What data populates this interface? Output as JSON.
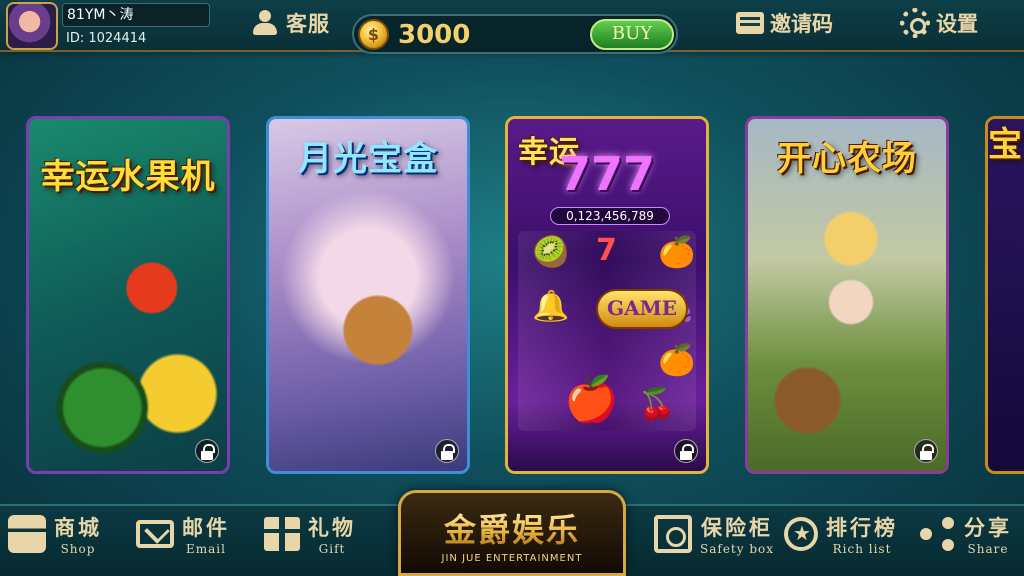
{
  "header": {
    "username": "81YM丶涛",
    "user_id": "ID: 1024414",
    "customer_service_label": "客服",
    "coins": "3000",
    "buy_label": "BUY",
    "invite_code_label": "邀请码",
    "settings_label": "设置"
  },
  "games": [
    {
      "title": "幸运水果机",
      "locked": true
    },
    {
      "title": "月光宝盒",
      "locked": true
    },
    {
      "title": "幸运",
      "reel_title": "777",
      "jackpot": "0,123,456,789",
      "badge": "GAME",
      "locked": true
    },
    {
      "title": "开心农场",
      "locked": true
    },
    {
      "title": "宝",
      "locked": false
    }
  ],
  "bottom_nav": [
    {
      "cn": "商城",
      "en": "Shop"
    },
    {
      "cn": "邮件",
      "en": "Email"
    },
    {
      "cn": "礼物",
      "en": "Gift"
    },
    {
      "cn": "保险柜",
      "en": "Safety box"
    },
    {
      "cn": "排行榜",
      "en": "Rich list"
    },
    {
      "cn": "分享",
      "en": "Share"
    }
  ],
  "logo": {
    "cn": "金爵娱乐",
    "en": "JIN JUE ENTERTAINMENT"
  },
  "colors": {
    "accent_gold": "#e8d6a8",
    "buy_green": "#1f7e22",
    "background_teal": "#0f4f5c"
  }
}
